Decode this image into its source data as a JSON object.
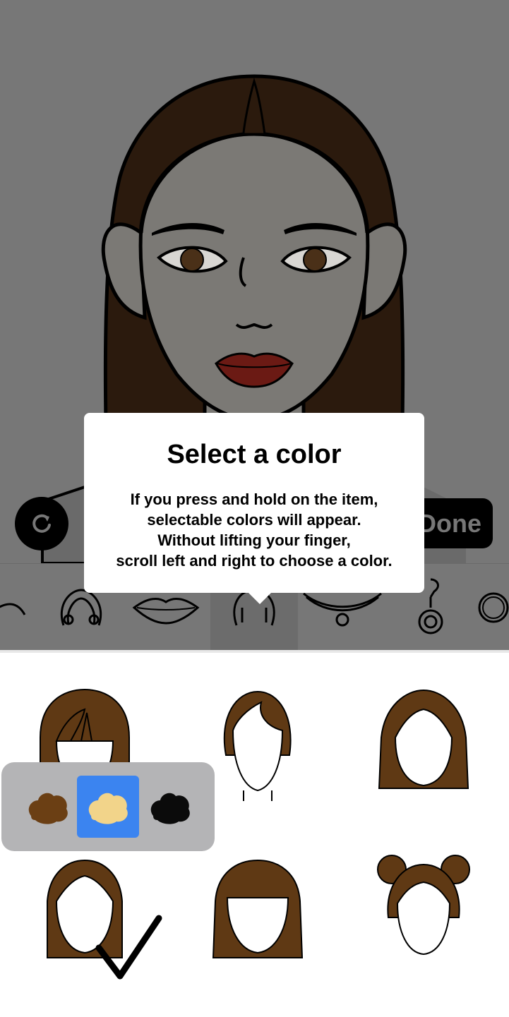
{
  "preview": {
    "rotate_icon": "rotate-icon",
    "done_label": "Done",
    "background_color": "#777777",
    "hair_color": "#2b1a0d",
    "skin_color": "#7b7975",
    "lip_color": "#6b1a14"
  },
  "tooltip": {
    "title": "Select a color",
    "lines": [
      "If you press and hold on the item,",
      "selectable colors will appear.",
      "Without lifting your finger,",
      "scroll left and right to choose a color."
    ]
  },
  "category_strip": {
    "items": [
      {
        "name": "eyebrow-icon"
      },
      {
        "name": "headband-icon"
      },
      {
        "name": "lips-icon"
      },
      {
        "name": "hair-icon",
        "selected": true
      },
      {
        "name": "necklace-icon"
      },
      {
        "name": "earring-icon"
      },
      {
        "name": "ring-icon"
      }
    ]
  },
  "hair_grid": {
    "hair_color": "#5f3914",
    "items": [
      {
        "style": "bangs-long"
      },
      {
        "style": "short-side-part"
      },
      {
        "style": "center-part-medium"
      },
      {
        "style": "center-part-long"
      },
      {
        "style": "blunt-bangs"
      },
      {
        "style": "space-buns"
      }
    ]
  },
  "color_picker": {
    "swatches": [
      {
        "color": "#6b3f14",
        "label": "brown"
      },
      {
        "color": "#f2d48a",
        "label": "blonde",
        "selected": true
      },
      {
        "color": "#0b0b0b",
        "label": "black"
      }
    ],
    "selected_color": "#3b84f0"
  }
}
